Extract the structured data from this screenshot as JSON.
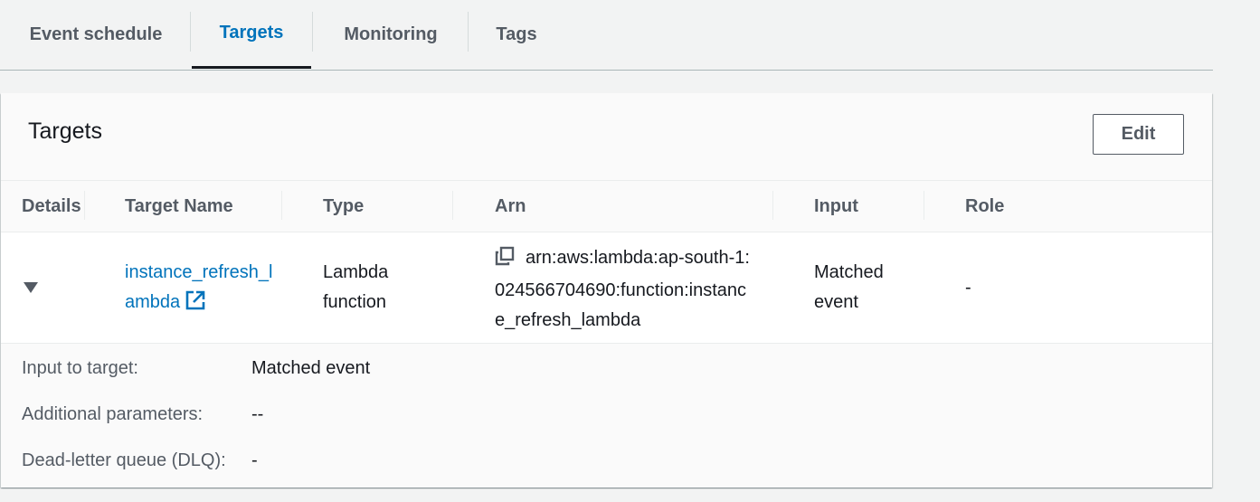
{
  "tabs": [
    {
      "label": "Event schedule",
      "active": false
    },
    {
      "label": "Targets",
      "active": true
    },
    {
      "label": "Monitoring",
      "active": false
    },
    {
      "label": "Tags",
      "active": false
    }
  ],
  "panel": {
    "title": "Targets",
    "edit_label": "Edit"
  },
  "table": {
    "columns": [
      "Details",
      "Target Name",
      "Type",
      "Arn",
      "Input",
      "Role"
    ],
    "row": {
      "target_name_line1": "instance_refresh_l",
      "target_name_line2": "ambda",
      "type_line1": "Lambda",
      "type_line2": "function",
      "arn_line1": "arn:aws:lambda:ap-south-1:",
      "arn_line2": "024566704690:function:instanc",
      "arn_line3": "e_refresh_lambda",
      "input_line1": "Matched",
      "input_line2": "event",
      "role": "-"
    }
  },
  "details": {
    "input_label": "Input to target:",
    "input_value": "Matched event",
    "additional_label": "Additional parameters:",
    "additional_value": "--",
    "dlq_label": "Dead-letter queue (DLQ):",
    "dlq_value": "-"
  },
  "icons": {
    "expand": "caret-down-icon",
    "external_link": "external-link-icon",
    "copy": "copy-icon"
  },
  "colors": {
    "link": "#0073bb",
    "active_tab": "#0073bb",
    "background": "#f2f3f3"
  }
}
